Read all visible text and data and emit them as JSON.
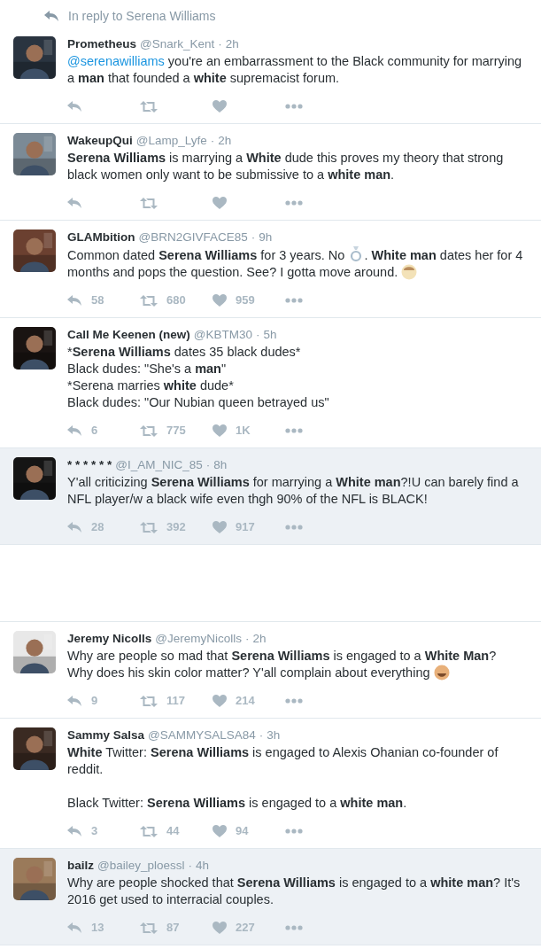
{
  "reply_context": "In reply to Serena Williams",
  "tweets": [
    {
      "name": "Prometheus",
      "handle": "@Snark_Kent",
      "separator": "·",
      "time": "2h",
      "highlighted": false,
      "paragraphs": [
        {
          "segments": [
            {
              "kind": "mention",
              "text": "@serenawilliams"
            },
            {
              "kind": "text",
              "text": " you're an embarrassment to the Black community for marrying a **man** that founded a **white** supremacist forum."
            }
          ]
        }
      ]
    },
    {
      "name": "WakeupQui",
      "handle": "@Lamp_Lyfe",
      "separator": "·",
      "time": "2h",
      "highlighted": false,
      "paragraphs": [
        {
          "segments": [
            {
              "kind": "text",
              "text": "**Serena Williams** is marrying a **White** dude this proves my theory that strong black women only want to be submissive to a **white man**."
            }
          ]
        }
      ]
    },
    {
      "name": "GLAMbition",
      "handle": "@BRN2GIVFACE85",
      "separator": "·",
      "time": "9h",
      "highlighted": false,
      "paragraphs": [
        {
          "segments": [
            {
              "kind": "text",
              "text": "Common dated **Serena Williams** for 3 years. No "
            },
            {
              "kind": "ring"
            },
            {
              "kind": "text",
              "text": ". **White man** dates her for 4 months and pops the question. See? I gotta move around. "
            },
            {
              "kind": "face"
            }
          ]
        }
      ],
      "counts": [
        "58",
        "680",
        "959"
      ]
    },
    {
      "name": "Call Me Keenen (new)",
      "handle": "@KBTM30",
      "separator": "·",
      "time": "5h",
      "highlighted": false,
      "paragraphs": [
        {
          "segments": [
            {
              "kind": "text",
              "text": "*"
            },
            {
              "kind": "text",
              "text": "**Serena Williams** dates 35 black dudes"
            },
            {
              "kind": "text",
              "text": "*"
            }
          ]
        },
        {
          "segments": [
            {
              "kind": "text",
              "text": "Black dudes: \"She's a **man**\""
            }
          ]
        },
        {
          "segments": [
            {
              "kind": "text",
              "text": "*"
            },
            {
              "kind": "text",
              "text": "Serena marries **white** dude"
            },
            {
              "kind": "text",
              "text": "*"
            }
          ]
        },
        {
          "segments": [
            {
              "kind": "text",
              "text": "Black dudes: \"Our Nubian queen betrayed us\""
            }
          ]
        }
      ],
      "counts": [
        "6",
        "775",
        "1K"
      ]
    },
    {
      "name": "* * * * * *",
      "handle": "@I_AM_NIC_85",
      "separator": "·",
      "time": "8h",
      "highlighted": true,
      "paragraphs": [
        {
          "segments": [
            {
              "kind": "text",
              "text": "Y'all criticizing **Serena Williams** for marrying a **White man**?!U can barely find a NFL player/w a black wife even thgh 90% of the NFL is BLACK!"
            }
          ]
        }
      ],
      "counts": [
        "28",
        "392",
        "917"
      ]
    }
  ],
  "tweets_lower": [
    {
      "name": "Jeremy Nicolls",
      "handle": "@JeremyNicolls",
      "separator": "·",
      "time": "2h",
      "highlighted": false,
      "paragraphs": [
        {
          "segments": [
            {
              "kind": "text",
              "text": "Why are people so mad that **Serena Williams** is engaged to a **White Man**? Why does his skin color matter? Y'all complain about everything "
            },
            {
              "kind": "laugh"
            }
          ]
        }
      ],
      "counts": [
        "9",
        "117",
        "214"
      ]
    },
    {
      "name": "Sammy Salsa",
      "handle": "@SAMMYSALSA84",
      "separator": "·",
      "time": "3h",
      "highlighted": false,
      "paragraphs": [
        {
          "segments": [
            {
              "kind": "text",
              "text": "**White** Twitter: **Serena Williams** is engaged to Alexis Ohanian co-founder of reddit."
            }
          ]
        },
        {
          "space_before": true,
          "segments": [
            {
              "kind": "text",
              "text": "Black Twitter: **Serena Williams** is engaged to a **white man**."
            }
          ]
        }
      ],
      "counts": [
        "3",
        "44",
        "94"
      ]
    },
    {
      "name": "bailz",
      "handle": "@bailey_ploessl",
      "separator": "·",
      "time": "4h",
      "highlighted": true,
      "paragraphs": [
        {
          "segments": [
            {
              "kind": "text",
              "text": "Why are people shocked that **Serena Williams** is engaged to a **white man**? It's 2016 get used to interracial couples."
            }
          ]
        }
      ],
      "counts": [
        "13",
        "87",
        "227"
      ]
    }
  ]
}
